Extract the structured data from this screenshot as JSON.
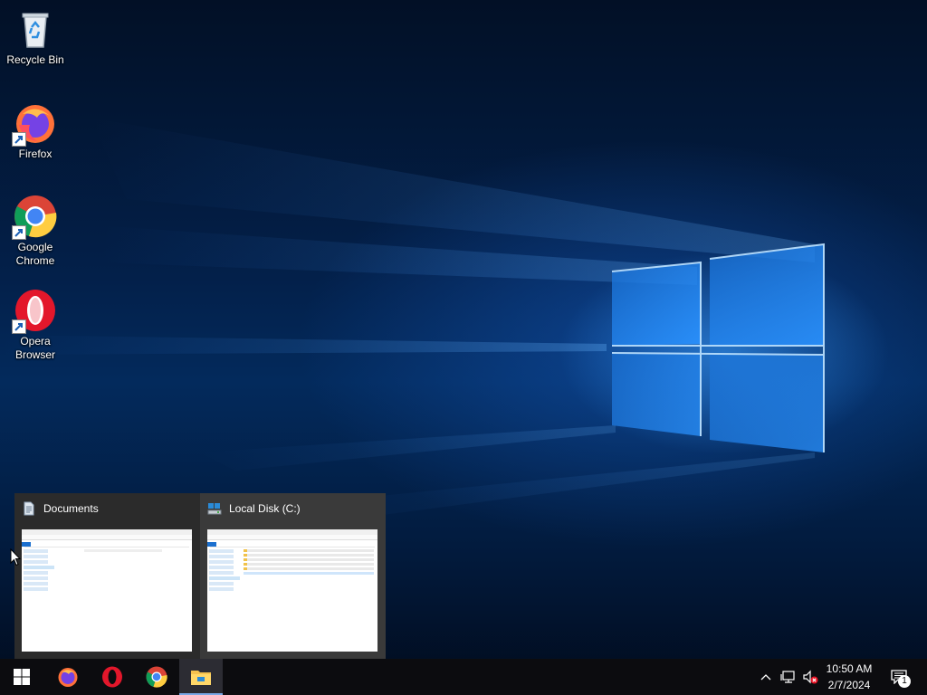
{
  "desktop": {
    "icons": [
      {
        "label": "Recycle Bin",
        "icon": "recycle-bin-icon"
      },
      {
        "label": "Firefox",
        "icon": "firefox-icon"
      },
      {
        "label": "Google Chrome",
        "icon": "chrome-icon"
      },
      {
        "label": "Opera Browser",
        "icon": "opera-icon"
      }
    ]
  },
  "thumbnails": [
    {
      "title": "Documents",
      "icon": "documents-folder-icon"
    },
    {
      "title": "Local Disk (C:)",
      "icon": "local-disk-icon"
    }
  ],
  "taskbar": {
    "apps": [
      {
        "name": "Start",
        "icon": "windows-start-icon"
      },
      {
        "name": "Firefox",
        "icon": "firefox-icon"
      },
      {
        "name": "Opera",
        "icon": "opera-icon"
      },
      {
        "name": "Google Chrome",
        "icon": "chrome-icon"
      },
      {
        "name": "File Explorer",
        "icon": "file-explorer-icon",
        "active": true
      }
    ],
    "tray": {
      "time": "10:50 AM",
      "date": "2/7/2024",
      "notification_count": "1"
    }
  },
  "colors": {
    "taskbar": "#0c0c0f",
    "accent": "#78a8e6",
    "thumbnail_popup": "#2b2b2b"
  }
}
